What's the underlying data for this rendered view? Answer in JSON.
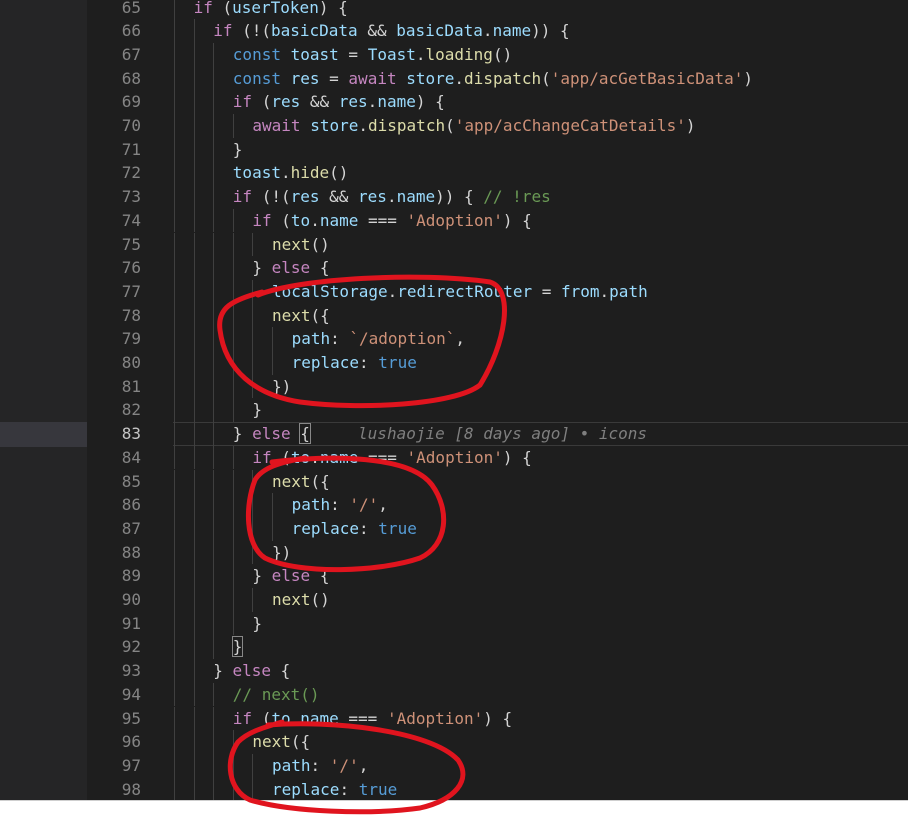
{
  "editor": {
    "lines": [
      {
        "num": "65",
        "indent": 1,
        "tokens": [
          {
            "t": "if",
            "c": "c"
          },
          {
            "t": " (",
            "c": "o"
          },
          {
            "t": "userToken",
            "c": "v"
          },
          {
            "t": ") {",
            "c": "o"
          }
        ]
      },
      {
        "num": "66",
        "indent": 2,
        "tokens": [
          {
            "t": "if",
            "c": "c"
          },
          {
            "t": " (!(",
            "c": "o"
          },
          {
            "t": "basicData",
            "c": "v"
          },
          {
            "t": " && ",
            "c": "o"
          },
          {
            "t": "basicData",
            "c": "v"
          },
          {
            "t": ".",
            "c": "o"
          },
          {
            "t": "name",
            "c": "v"
          },
          {
            "t": ")) {",
            "c": "o"
          }
        ]
      },
      {
        "num": "67",
        "indent": 3,
        "tokens": [
          {
            "t": "const",
            "c": "k"
          },
          {
            "t": " ",
            "c": "o"
          },
          {
            "t": "toast",
            "c": "v"
          },
          {
            "t": " = ",
            "c": "o"
          },
          {
            "t": "Toast",
            "c": "v"
          },
          {
            "t": ".",
            "c": "o"
          },
          {
            "t": "loading",
            "c": "f"
          },
          {
            "t": "()",
            "c": "o"
          }
        ]
      },
      {
        "num": "68",
        "indent": 3,
        "tokens": [
          {
            "t": "const",
            "c": "k"
          },
          {
            "t": " ",
            "c": "o"
          },
          {
            "t": "res",
            "c": "v"
          },
          {
            "t": " = ",
            "c": "o"
          },
          {
            "t": "await",
            "c": "c"
          },
          {
            "t": " ",
            "c": "o"
          },
          {
            "t": "store",
            "c": "v"
          },
          {
            "t": ".",
            "c": "o"
          },
          {
            "t": "dispatch",
            "c": "f"
          },
          {
            "t": "(",
            "c": "o"
          },
          {
            "t": "'app/acGetBasicData'",
            "c": "s"
          },
          {
            "t": ")",
            "c": "o"
          }
        ]
      },
      {
        "num": "69",
        "indent": 3,
        "tokens": [
          {
            "t": "if",
            "c": "c"
          },
          {
            "t": " (",
            "c": "o"
          },
          {
            "t": "res",
            "c": "v"
          },
          {
            "t": " && ",
            "c": "o"
          },
          {
            "t": "res",
            "c": "v"
          },
          {
            "t": ".",
            "c": "o"
          },
          {
            "t": "name",
            "c": "v"
          },
          {
            "t": ") {",
            "c": "o"
          }
        ]
      },
      {
        "num": "70",
        "indent": 4,
        "tokens": [
          {
            "t": "await",
            "c": "c"
          },
          {
            "t": " ",
            "c": "o"
          },
          {
            "t": "store",
            "c": "v"
          },
          {
            "t": ".",
            "c": "o"
          },
          {
            "t": "dispatch",
            "c": "f"
          },
          {
            "t": "(",
            "c": "o"
          },
          {
            "t": "'app/acChangeCatDetails'",
            "c": "s"
          },
          {
            "t": ")",
            "c": "o"
          }
        ]
      },
      {
        "num": "71",
        "indent": 3,
        "tokens": [
          {
            "t": "}",
            "c": "o"
          }
        ]
      },
      {
        "num": "72",
        "indent": 3,
        "tokens": [
          {
            "t": "toast",
            "c": "v"
          },
          {
            "t": ".",
            "c": "o"
          },
          {
            "t": "hide",
            "c": "f"
          },
          {
            "t": "()",
            "c": "o"
          }
        ]
      },
      {
        "num": "73",
        "indent": 3,
        "tokens": [
          {
            "t": "if",
            "c": "c"
          },
          {
            "t": " (!(",
            "c": "o"
          },
          {
            "t": "res",
            "c": "v"
          },
          {
            "t": " && ",
            "c": "o"
          },
          {
            "t": "res",
            "c": "v"
          },
          {
            "t": ".",
            "c": "o"
          },
          {
            "t": "name",
            "c": "v"
          },
          {
            "t": ")) { ",
            "c": "o"
          },
          {
            "t": "// !res",
            "c": "cm"
          }
        ]
      },
      {
        "num": "74",
        "indent": 4,
        "tokens": [
          {
            "t": "if",
            "c": "c"
          },
          {
            "t": " (",
            "c": "o"
          },
          {
            "t": "to",
            "c": "v"
          },
          {
            "t": ".",
            "c": "o"
          },
          {
            "t": "name",
            "c": "v"
          },
          {
            "t": " === ",
            "c": "o"
          },
          {
            "t": "'Adoption'",
            "c": "s"
          },
          {
            "t": ") {",
            "c": "o"
          }
        ]
      },
      {
        "num": "75",
        "indent": 5,
        "tokens": [
          {
            "t": "next",
            "c": "f"
          },
          {
            "t": "()",
            "c": "o"
          }
        ]
      },
      {
        "num": "76",
        "indent": 4,
        "tokens": [
          {
            "t": "} ",
            "c": "o"
          },
          {
            "t": "else",
            "c": "c"
          },
          {
            "t": " {",
            "c": "o"
          }
        ]
      },
      {
        "num": "77",
        "indent": 5,
        "tokens": [
          {
            "t": "localStorage",
            "c": "v"
          },
          {
            "t": ".",
            "c": "o"
          },
          {
            "t": "redirectRouter",
            "c": "v"
          },
          {
            "t": " = ",
            "c": "o"
          },
          {
            "t": "from",
            "c": "v"
          },
          {
            "t": ".",
            "c": "o"
          },
          {
            "t": "path",
            "c": "v"
          }
        ]
      },
      {
        "num": "78",
        "indent": 5,
        "tokens": [
          {
            "t": "next",
            "c": "f"
          },
          {
            "t": "({",
            "c": "o"
          }
        ]
      },
      {
        "num": "79",
        "indent": 6,
        "tokens": [
          {
            "t": "path",
            "c": "v"
          },
          {
            "t": ": ",
            "c": "o"
          },
          {
            "t": "`/adoption`",
            "c": "s"
          },
          {
            "t": ",",
            "c": "o"
          }
        ]
      },
      {
        "num": "80",
        "indent": 6,
        "tokens": [
          {
            "t": "replace",
            "c": "v"
          },
          {
            "t": ": ",
            "c": "o"
          },
          {
            "t": "true",
            "c": "k"
          }
        ]
      },
      {
        "num": "81",
        "indent": 5,
        "tokens": [
          {
            "t": "})",
            "c": "o"
          }
        ]
      },
      {
        "num": "82",
        "indent": 4,
        "tokens": [
          {
            "t": "}",
            "c": "o"
          }
        ]
      },
      {
        "num": "83",
        "indent": 3,
        "current": true,
        "tokens": [
          {
            "t": "} ",
            "c": "o"
          },
          {
            "t": "else",
            "c": "c"
          },
          {
            "t": " ",
            "c": "o"
          },
          {
            "t": "{",
            "c": "o",
            "box": true
          },
          {
            "t": "     lushaojie [8 days ago] • icons",
            "c": "blame"
          }
        ]
      },
      {
        "num": "84",
        "indent": 4,
        "tokens": [
          {
            "t": "if",
            "c": "c"
          },
          {
            "t": " (",
            "c": "o"
          },
          {
            "t": "to",
            "c": "v"
          },
          {
            "t": ".",
            "c": "o"
          },
          {
            "t": "name",
            "c": "v"
          },
          {
            "t": " === ",
            "c": "o"
          },
          {
            "t": "'Adoption'",
            "c": "s"
          },
          {
            "t": ") {",
            "c": "o"
          }
        ]
      },
      {
        "num": "85",
        "indent": 5,
        "tokens": [
          {
            "t": "next",
            "c": "f"
          },
          {
            "t": "({",
            "c": "o"
          }
        ]
      },
      {
        "num": "86",
        "indent": 6,
        "tokens": [
          {
            "t": "path",
            "c": "v"
          },
          {
            "t": ": ",
            "c": "o"
          },
          {
            "t": "'/'",
            "c": "s"
          },
          {
            "t": ",",
            "c": "o"
          }
        ]
      },
      {
        "num": "87",
        "indent": 6,
        "tokens": [
          {
            "t": "replace",
            "c": "v"
          },
          {
            "t": ": ",
            "c": "o"
          },
          {
            "t": "true",
            "c": "k"
          }
        ]
      },
      {
        "num": "88",
        "indent": 5,
        "tokens": [
          {
            "t": "})",
            "c": "o"
          }
        ]
      },
      {
        "num": "89",
        "indent": 4,
        "tokens": [
          {
            "t": "} ",
            "c": "o"
          },
          {
            "t": "else",
            "c": "c"
          },
          {
            "t": " {",
            "c": "o"
          }
        ]
      },
      {
        "num": "90",
        "indent": 5,
        "tokens": [
          {
            "t": "next",
            "c": "f"
          },
          {
            "t": "()",
            "c": "o"
          }
        ]
      },
      {
        "num": "91",
        "indent": 4,
        "tokens": [
          {
            "t": "}",
            "c": "o"
          }
        ]
      },
      {
        "num": "92",
        "indent": 3,
        "tokens": [
          {
            "t": "}",
            "c": "o",
            "box": true
          }
        ]
      },
      {
        "num": "93",
        "indent": 2,
        "tokens": [
          {
            "t": "} ",
            "c": "o"
          },
          {
            "t": "else",
            "c": "c"
          },
          {
            "t": " {",
            "c": "o"
          }
        ]
      },
      {
        "num": "94",
        "indent": 3,
        "tokens": [
          {
            "t": "// next()",
            "c": "cm"
          }
        ]
      },
      {
        "num": "95",
        "indent": 3,
        "tokens": [
          {
            "t": "if",
            "c": "c"
          },
          {
            "t": " (",
            "c": "o"
          },
          {
            "t": "to",
            "c": "v"
          },
          {
            "t": ".",
            "c": "o"
          },
          {
            "t": "name",
            "c": "v"
          },
          {
            "t": " === ",
            "c": "o"
          },
          {
            "t": "'Adoption'",
            "c": "s"
          },
          {
            "t": ") {",
            "c": "o"
          }
        ]
      },
      {
        "num": "96",
        "indent": 4,
        "tokens": [
          {
            "t": "next",
            "c": "f"
          },
          {
            "t": "({",
            "c": "o"
          }
        ]
      },
      {
        "num": "97",
        "indent": 5,
        "tokens": [
          {
            "t": "path",
            "c": "v"
          },
          {
            "t": ": ",
            "c": "o"
          },
          {
            "t": "'/'",
            "c": "s"
          },
          {
            "t": ",",
            "c": "o"
          }
        ]
      },
      {
        "num": "98",
        "indent": 5,
        "tokens": [
          {
            "t": "replace",
            "c": "v"
          },
          {
            "t": ": ",
            "c": "o"
          },
          {
            "t": "true",
            "c": "k"
          }
        ]
      }
    ]
  },
  "colors": {
    "annotation": "#e0141e",
    "editor_bg": "#1e1e1e",
    "sidebar_bg": "#252526"
  }
}
